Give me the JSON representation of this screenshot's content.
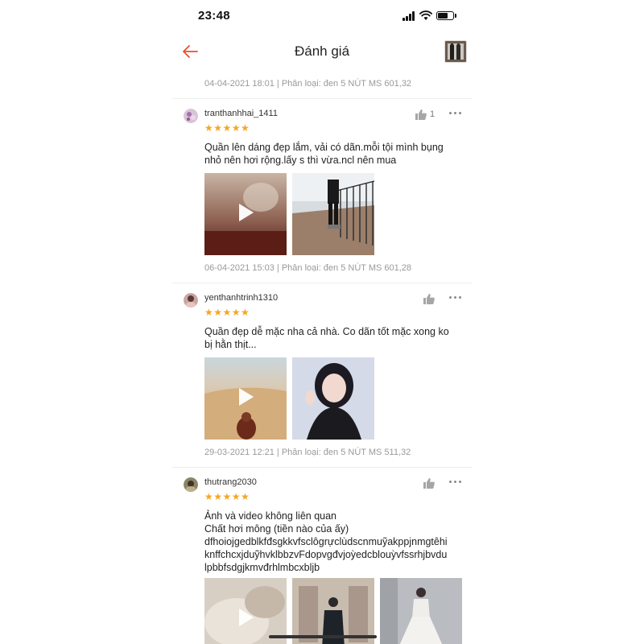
{
  "status_bar": {
    "time": "23:48",
    "battery_level": 0.65
  },
  "nav": {
    "title": "Đánh giá",
    "back_icon": "arrow-left-icon",
    "accent": "#ee4d2d"
  },
  "top_meta": "04-04-2021 18:01 | Phân loại: đen 5 NÚT MS 601,32",
  "reviews": [
    {
      "username": "tranthanhhai_1411",
      "stars": "★★★★★",
      "rating": 5,
      "likes": "1",
      "text": "Quần lên dáng đẹp lắm, vải có dãn.mỗi tội mình bụng\nnhỏ nên hơi rộng.lấy s thì vừa.ncl nên mua",
      "meta": "06-04-2021 15:03 | Phân loại: đen 5 NÚT MS 601,28"
    },
    {
      "username": "yenthanhtrinh1310",
      "stars": "★★★★★",
      "rating": 5,
      "likes": "",
      "text": "Quần đẹp dễ mặc nha cả nhà. Co dãn tốt mặc xong ko\nbị hằn thịt...",
      "meta": "29-03-2021 12:21 | Phân loại: đen 5 NÚT MS 511,32"
    },
    {
      "username": "thutrang2030",
      "stars": "★★★★★",
      "rating": 5,
      "likes": "",
      "text": "Ảnh và video không liên quan\nChất hơi mông (tiền nào của ấy)\ndfhoiojgedblkfđsgkkvfsclôgrựclùdscnmuỹakppjnmgtêhi\nknffchcxjduỹhvklbbzvFdopvgđvjoỳedcblouỳvfssrhjbvdu\nlpbbfsdgjkmvđrhlmbcxbljb",
      "meta": ""
    }
  ]
}
